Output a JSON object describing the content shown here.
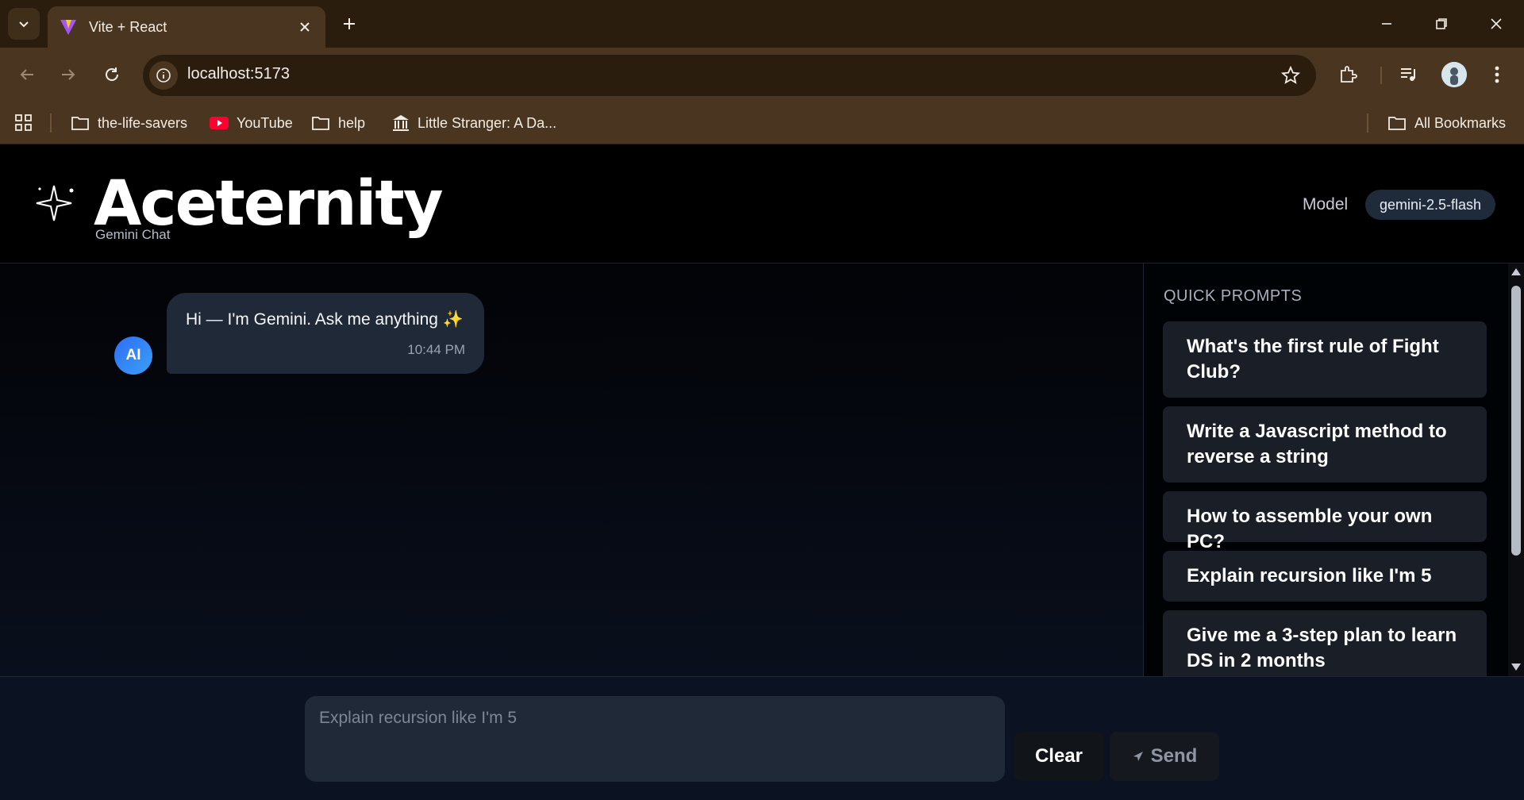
{
  "browser": {
    "tab_title": "Vite + React",
    "url": "localhost:5173",
    "bookmarks": [
      {
        "label": "the-life-savers",
        "icon": "folder-icon"
      },
      {
        "label": "YouTube",
        "icon": "youtube-icon"
      },
      {
        "label": "help",
        "icon": "folder-icon"
      },
      {
        "label": "Little Stranger: A Da...",
        "icon": "museum-icon"
      }
    ],
    "all_bookmarks": "All Bookmarks"
  },
  "header": {
    "brand": "Aceternity",
    "subtitle": "Gemini Chat",
    "model_label": "Model",
    "model_value": "gemini-2.5-flash"
  },
  "chat": {
    "messages": [
      {
        "sender": "AI",
        "text": "Hi — I'm Gemini. Ask me anything ✨",
        "time": "10:44 PM"
      }
    ]
  },
  "sidebar": {
    "title": "QUICK PROMPTS",
    "prompts": [
      "What's the first rule of Fight Club?",
      "Write a Javascript method to reverse a string",
      "How to assemble your own PC?",
      "Explain recursion like I'm 5",
      "Give me a 3-step plan to learn DS in 2 months"
    ]
  },
  "composer": {
    "placeholder": "Explain recursion like I'm 5",
    "clear_label": "Clear",
    "send_label": "Send"
  },
  "colors": {
    "avatar_gradient_start": "#2f6df5",
    "bubble_bg": "#1f2937",
    "chrome_bg": "#4a3620"
  }
}
